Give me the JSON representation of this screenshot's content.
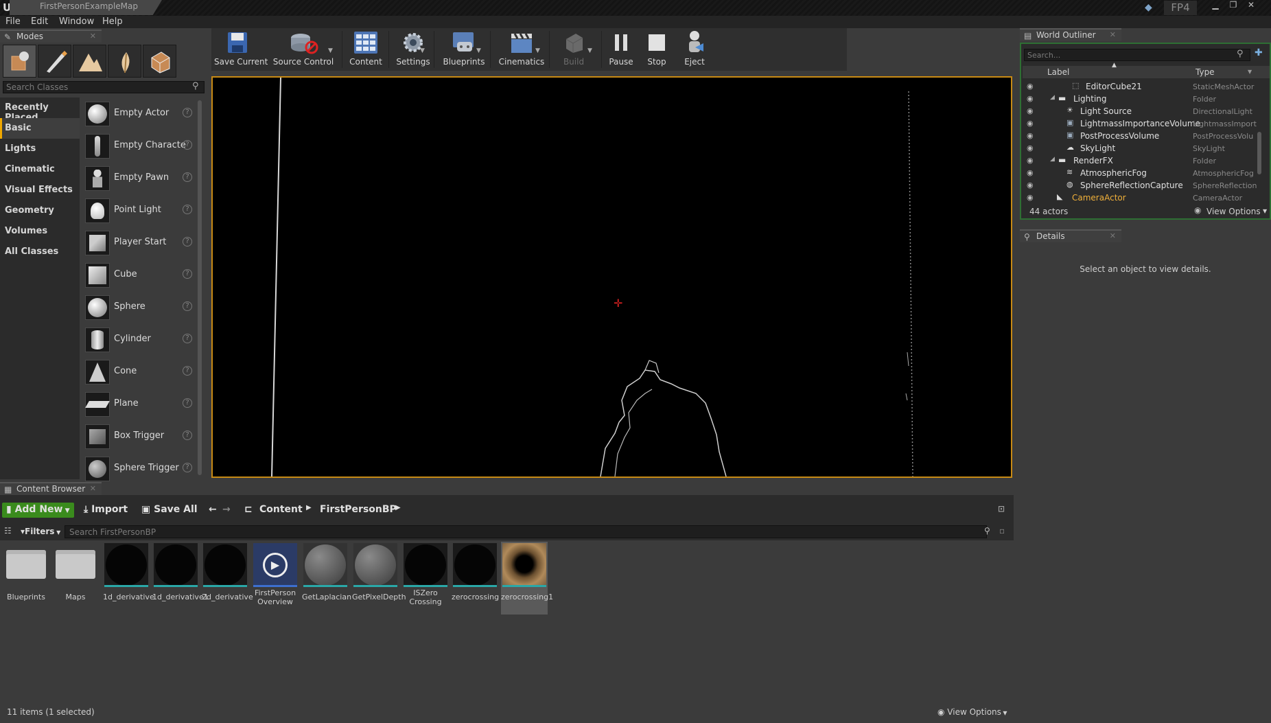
{
  "window": {
    "title": "FirstPersonExampleMap",
    "project": "FP4",
    "logo": "unreal-logo"
  },
  "menu": [
    "File",
    "Edit",
    "Window",
    "Help"
  ],
  "modes": {
    "tab_label": "Modes",
    "search_placeholder": "Search Classes",
    "categories": [
      "Recently Placed",
      "Basic",
      "Lights",
      "Cinematic",
      "Visual Effects",
      "Geometry",
      "Volumes",
      "All Classes"
    ],
    "selected_category": "Basic",
    "classes": [
      "Empty Actor",
      "Empty Characte",
      "Empty Pawn",
      "Point Light",
      "Player Start",
      "Cube",
      "Sphere",
      "Cylinder",
      "Cone",
      "Plane",
      "Box Trigger",
      "Sphere Trigger"
    ]
  },
  "toolbar": {
    "buttons": [
      "Save Current",
      "Source Control",
      "Content",
      "Settings",
      "Blueprints",
      "Cinematics",
      "Build",
      "Pause",
      "Stop",
      "Eject"
    ]
  },
  "outliner": {
    "tab_label": "World Outliner",
    "search_placeholder": "Search...",
    "col_label": "Label",
    "col_type": "Type",
    "rows": [
      {
        "label": "EditorCube21",
        "type": "StaticMeshActor"
      },
      {
        "label": "Lighting",
        "type": "Folder"
      },
      {
        "label": "Light Source",
        "type": "DirectionalLight"
      },
      {
        "label": "LightmassImportanceVolume",
        "type": "LightmassImport"
      },
      {
        "label": "PostProcessVolume",
        "type": "PostProcessVolu"
      },
      {
        "label": "SkyLight",
        "type": "SkyLight"
      },
      {
        "label": "RenderFX",
        "type": "Folder"
      },
      {
        "label": "AtmosphericFog",
        "type": "AtmosphericFog"
      },
      {
        "label": "SphereReflectionCapture",
        "type": "SphereReflection"
      },
      {
        "label": "CameraActor",
        "type": "CameraActor"
      }
    ],
    "actor_count": "44 actors",
    "view_options": "View Options"
  },
  "details": {
    "tab_label": "Details",
    "empty_message": "Select an object to view details."
  },
  "content_browser": {
    "tab_label": "Content Browser",
    "add_new": "Add New",
    "import": "Import",
    "save_all": "Save All",
    "path": [
      "Content",
      "FirstPersonBP"
    ],
    "filters": "Filters",
    "search_placeholder": "Search FirstPersonBP",
    "assets": [
      "Blueprints",
      "Maps",
      "1d_derivative",
      "1d_derivative1",
      "2d_derivative",
      "FirstPerson Overview",
      "GetLaplacian",
      "GetPixelDepth",
      "ISZero Crossing",
      "zerocrossing",
      "zerocrossing1"
    ],
    "selected_asset": "zerocrossing1",
    "status": "11 items (1 selected)",
    "view_options": "View Options"
  },
  "colors": {
    "accent": "#f0a800",
    "add_new_green": "#3a8b1d",
    "viewport_border": "#c88a14",
    "outliner_border": "#2e6f33",
    "camera_actor_label": "#f0b03a"
  }
}
